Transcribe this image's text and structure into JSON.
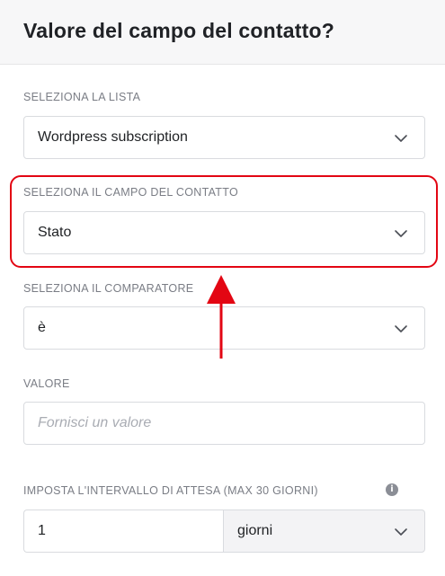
{
  "header": {
    "title": "Valore del campo del contatto?"
  },
  "list_select": {
    "label": "SELEZIONA LA LISTA",
    "value": "Wordpress subscription"
  },
  "contact_field_select": {
    "label": "SELEZIONA IL CAMPO DEL CONTATTO",
    "value": "Stato"
  },
  "comparator_select": {
    "label": "SELEZIONA IL COMPARATORE",
    "value": "è"
  },
  "value_input": {
    "label": "VALORE",
    "placeholder": "Fornisci un valore"
  },
  "wait_interval": {
    "label": "IMPOSTA L'INTERVALLO DI ATTESA (MAX 30 GIORNI)",
    "amount": "1",
    "unit": "giorni"
  },
  "annotation": {
    "highlight_color": "#e30613"
  },
  "icons": [
    "chevron-down-icon",
    "info-icon",
    "arrow-up-icon"
  ]
}
